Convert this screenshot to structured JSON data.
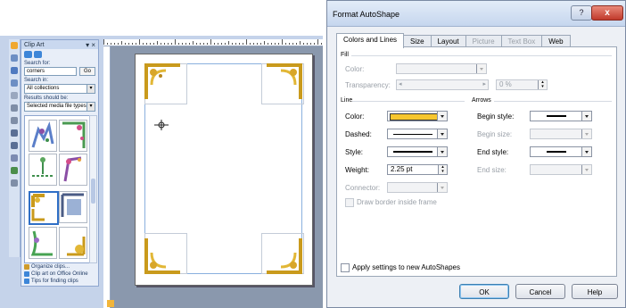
{
  "publisher": {
    "clip_art_pane": {
      "title": "Clip Art",
      "search_for_label": "Search for:",
      "search_value": "corners",
      "go_label": "Go",
      "search_in_label": "Search in:",
      "search_in_value": "All collections",
      "results_label": "Results should be:",
      "results_value": "Selected media file types",
      "links": [
        "Organize clips...",
        "Clip art on Office Online",
        "Tips for finding clips"
      ]
    }
  },
  "dialog": {
    "title": "Format AutoShape",
    "help_button": "?",
    "close_button": "x",
    "tabs": [
      {
        "label": "Colors and Lines",
        "active": true,
        "enabled": true
      },
      {
        "label": "Size",
        "active": false,
        "enabled": true
      },
      {
        "label": "Layout",
        "active": false,
        "enabled": true
      },
      {
        "label": "Picture",
        "active": false,
        "enabled": false
      },
      {
        "label": "Text Box",
        "active": false,
        "enabled": false
      },
      {
        "label": "Web",
        "active": false,
        "enabled": true
      }
    ],
    "fill": {
      "section_label": "Fill",
      "color_label": "Color:",
      "transparency_label": "Transparency:",
      "transparency_value": "0 %"
    },
    "line": {
      "section_label": "Line",
      "color_label": "Color:",
      "color_value": "#f7c62e",
      "dashed_label": "Dashed:",
      "style_label": "Style:",
      "weight_label": "Weight:",
      "weight_value": "2.25 pt",
      "connector_label": "Connector:",
      "draw_border_label": "Draw border inside frame"
    },
    "arrows": {
      "section_label": "Arrows",
      "begin_style_label": "Begin style:",
      "begin_size_label": "Begin size:",
      "end_style_label": "End style:",
      "end_size_label": "End size:"
    },
    "apply_label": "Apply settings to new AutoShapes",
    "ok_label": "OK",
    "cancel_label": "Cancel",
    "help_label": "Help"
  }
}
